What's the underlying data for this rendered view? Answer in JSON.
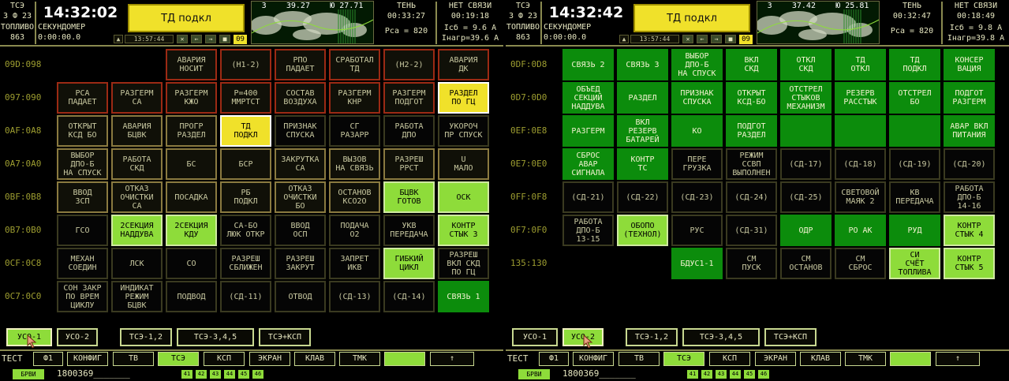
{
  "panels": [
    {
      "header": {
        "tse": "ТСЭ",
        "f": "3 Ф 23",
        "toplivo_label": "ТОПЛИВО",
        "toplivo": "863",
        "clock": "14:32:02",
        "stopwatch_label": "СЕКУНДОМЕР",
        "stopwatch": "0:00:00.0",
        "message": "ТД подкл",
        "map_a": "3",
        "map_b": "39.27",
        "map_c": "Ю 27.71",
        "shadow_label": "ТЕНЬ",
        "shadow": "00:33:27",
        "pca": "Рса = 820",
        "nolink_label": "НЕТ СВЯЗИ",
        "nolink": "00:19:18",
        "isb": "Iсб = 9.6 А",
        "inagr": "Iнагр=39.6 А",
        "toolbar_time": "13:57:44",
        "page": "09"
      },
      "rows": [
        {
          "label": "09D:098",
          "cells": [
            {
              "t": "",
              "s": "e"
            },
            {
              "t": "",
              "s": "e"
            },
            {
              "t": "АВАРИЯ\nНОСИТ",
              "s": "r"
            },
            {
              "t": "(Н1-2)",
              "s": "r"
            },
            {
              "t": "РПО\nПАДАЕТ",
              "s": "r"
            },
            {
              "t": "СРАБОТАЛ\nТД",
              "s": "r"
            },
            {
              "t": "(Н2-2)",
              "s": "r"
            },
            {
              "t": "АВАРИЯ\nДК",
              "s": "r"
            }
          ]
        },
        {
          "label": "097:090",
          "cells": [
            {
              "t": "РСА\nПАДАЕТ",
              "s": "r"
            },
            {
              "t": "РАЗГЕРМ\nСА",
              "s": "r"
            },
            {
              "t": "РАЗГЕРМ\nКЖО",
              "s": "r"
            },
            {
              "t": "Р=400\nММРТСТ",
              "s": "r"
            },
            {
              "t": "СОСТАВ\nВОЗДУХА",
              "s": "r"
            },
            {
              "t": "РАЗГЕРМ\nКНР",
              "s": "r"
            },
            {
              "t": "РАЗГЕРМ\nПОДГОТ",
              "s": "r"
            },
            {
              "t": "РАЗДЕЛ\nПО ГЦ",
              "s": "y"
            }
          ]
        },
        {
          "label": "0AF:0A8",
          "cells": [
            {
              "t": "ОТКРЫТ\nКСД БО",
              "s": "b"
            },
            {
              "t": "АВАРИЯ\nБЦВК",
              "s": "b"
            },
            {
              "t": "ПРОГР\nРАЗДЕЛ",
              "s": "b"
            },
            {
              "t": "ТД\nПОДКЛ",
              "s": "y"
            },
            {
              "t": "ПРИЗНАК\nСПУСКА",
              "s": "k"
            },
            {
              "t": "СГ\nРАЗАРР",
              "s": "k"
            },
            {
              "t": "РАБОТА\nДПО",
              "s": "k"
            },
            {
              "t": "УКОРОЧ\nПР СПУСК",
              "s": "k"
            }
          ]
        },
        {
          "label": "0A7:0A0",
          "cells": [
            {
              "t": "ВЫБОР\nДПО-Б\nНА СПУСК",
              "s": "b"
            },
            {
              "t": "РАБОТА\nСКД",
              "s": "b"
            },
            {
              "t": "БС",
              "s": "b"
            },
            {
              "t": "БСР",
              "s": "b"
            },
            {
              "t": "ЗАКРУТКА\nСА",
              "s": "b"
            },
            {
              "t": "ВЫЗОВ\nНА СВЯЗЬ",
              "s": "b"
            },
            {
              "t": "РАЗРЕШ\nРРСТ",
              "s": "b"
            },
            {
              "t": "U\nМАЛО",
              "s": "b"
            }
          ]
        },
        {
          "label": "0BF:0B8",
          "cells": [
            {
              "t": "ВВОД\nЗСП",
              "s": "b"
            },
            {
              "t": "ОТКАЗ\nОЧИСТКИ\nСА",
              "s": "b"
            },
            {
              "t": "ПОСАДКА",
              "s": "b"
            },
            {
              "t": "РБ\nПОДКЛ",
              "s": "b"
            },
            {
              "t": "ОТКАЗ\nОЧИСТКИ\nБО",
              "s": "b"
            },
            {
              "t": "ОСТАНОВ\nКСО2О",
              "s": "b"
            },
            {
              "t": "БЦВК\nГОТОВ",
              "s": "lg"
            },
            {
              "t": "ОСК",
              "s": "lg"
            }
          ]
        },
        {
          "label": "0B7:0B0",
          "cells": [
            {
              "t": "ГСО",
              "s": "k"
            },
            {
              "t": "2СЕКЦИЯ\nНАДДУВА",
              "s": "lg"
            },
            {
              "t": "2СЕКЦИЯ\nКДУ",
              "s": "lg"
            },
            {
              "t": "СА-БО\nЛЮК ОТКР",
              "s": "k"
            },
            {
              "t": "ВВОД\nОСП",
              "s": "k"
            },
            {
              "t": "ПОДАЧА\nО2",
              "s": "k"
            },
            {
              "t": "УКВ\nПЕРЕДАЧА",
              "s": "k"
            },
            {
              "t": "КОНТР\nСТЫК 3",
              "s": "lg"
            }
          ]
        },
        {
          "label": "0CF:0C8",
          "cells": [
            {
              "t": "МЕХАН\nСОЕДИН",
              "s": "k"
            },
            {
              "t": "ЛСК",
              "s": "k"
            },
            {
              "t": "СО",
              "s": "k"
            },
            {
              "t": "РАЗРЕШ\nСБЛИЖЕН",
              "s": "k"
            },
            {
              "t": "РАЗРЕШ\nЗАКРУТ",
              "s": "k"
            },
            {
              "t": "ЗАПРЕТ\nИКВ",
              "s": "k"
            },
            {
              "t": "ГИБКИЙ\nЦИКЛ",
              "s": "lg"
            },
            {
              "t": "РАЗРЕШ\nВКЛ СКД\nПО ГЦ",
              "s": "k"
            }
          ]
        },
        {
          "label": "0C7:0C0",
          "cells": [
            {
              "t": "СОН ЗАКР\nПО ВРЕМ\nЦИКЛУ",
              "s": "k"
            },
            {
              "t": "ИНДИКАТ\nРЕЖИМ\nБЦВК",
              "s": "k"
            },
            {
              "t": "ПОДВОД",
              "s": "k"
            },
            {
              "t": "(СД-11)",
              "s": "k"
            },
            {
              "t": "ОТВОД",
              "s": "k"
            },
            {
              "t": "(СД-13)",
              "s": "k"
            },
            {
              "t": "(СД-14)",
              "s": "k"
            },
            {
              "t": "СВЯЗЬ 1",
              "s": "g"
            }
          ]
        }
      ],
      "uso": [
        {
          "label": "УСО-1",
          "active": true
        },
        {
          "label": "УСО-2",
          "active": false
        },
        {
          "label": "ТСЭ-1,2",
          "active": false
        },
        {
          "label": "ТСЭ-3,4,5",
          "active": false
        },
        {
          "label": "ТСЭ+КСП",
          "active": false
        }
      ],
      "cursor_on": 0
    },
    {
      "header": {
        "tse": "ТСЭ",
        "f": "3 Ф 23",
        "toplivo_label": "ТОПЛИВО",
        "toplivo": "863",
        "clock": "14:32:42",
        "stopwatch_label": "СЕКУНДОМЕР",
        "stopwatch": "0:00:00.0",
        "message": "ТД подкл",
        "map_a": "3",
        "map_b": "37.42",
        "map_c": "Ю 25.81",
        "shadow_label": "ТЕНЬ",
        "shadow": "00:32:47",
        "pca": "Рса = 820",
        "nolink_label": "НЕТ СВЯЗИ",
        "nolink": "00:18:49",
        "isb": "Iсб = 9.8 А",
        "inagr": "Iнагр=39.8 А",
        "toolbar_time": "13:57:44",
        "page": "09"
      },
      "rows": [
        {
          "label": "0DF:0D8",
          "cells": [
            {
              "t": "СВЯЗЬ 2",
              "s": "g"
            },
            {
              "t": "СВЯЗЬ 3",
              "s": "g"
            },
            {
              "t": "ВЫБОР\nДПО-Б\nНА СПУСК",
              "s": "g"
            },
            {
              "t": "ВКЛ\nСКД",
              "s": "g"
            },
            {
              "t": "ОТКЛ\nСКД",
              "s": "g"
            },
            {
              "t": "ТД\nОТКЛ",
              "s": "g"
            },
            {
              "t": "ТД\nПОДКЛ",
              "s": "g"
            },
            {
              "t": "КОНСЕР\nВАЦИЯ",
              "s": "g"
            }
          ]
        },
        {
          "label": "0D7:0D0",
          "cells": [
            {
              "t": "ОБЪЕД\nСЕКЦИЙ\nНАДДУВА",
              "s": "g"
            },
            {
              "t": "РАЗДЕЛ",
              "s": "g"
            },
            {
              "t": "ПРИЗНАК\nСПУСКА",
              "s": "g"
            },
            {
              "t": "ОТКРЫТ\nКСД-БО",
              "s": "g"
            },
            {
              "t": "ОТСТРЕЛ\nСТЫКОВ\nМЕХАНИЗМ",
              "s": "g"
            },
            {
              "t": "РЕЗЕРВ\nРАССТЫК",
              "s": "g"
            },
            {
              "t": "ОТСТРЕЛ\nБО",
              "s": "g"
            },
            {
              "t": "ПОДГОТ\nРАЗГЕРМ",
              "s": "g"
            }
          ]
        },
        {
          "label": "0EF:0E8",
          "cells": [
            {
              "t": "РАЗГЕРМ",
              "s": "g"
            },
            {
              "t": "ВКЛ\nРЕЗЕРВ\nБАТАРЕЙ",
              "s": "g"
            },
            {
              "t": "КО",
              "s": "g"
            },
            {
              "t": "ПОДГОТ\nРАЗДЕЛ",
              "s": "g"
            },
            {
              "t": "",
              "s": "g"
            },
            {
              "t": "",
              "s": "g"
            },
            {
              "t": "",
              "s": "g"
            },
            {
              "t": "АВАР ВКЛ\nПИТАНИЯ",
              "s": "g"
            }
          ]
        },
        {
          "label": "0E7:0E0",
          "cells": [
            {
              "t": "СБРОС\nАВАР\nСИГНАЛА",
              "s": "g"
            },
            {
              "t": "КОНТР\nТС",
              "s": "g"
            },
            {
              "t": "ПЕРЕ\nГРУЗКА",
              "s": "k"
            },
            {
              "t": "РЕЖИМ\nССВП\nВЫПОЛНЕН",
              "s": "k"
            },
            {
              "t": "(СД-17)",
              "s": "k"
            },
            {
              "t": "(СД-18)",
              "s": "k"
            },
            {
              "t": "(СД-19)",
              "s": "k"
            },
            {
              "t": "(СД-20)",
              "s": "k"
            }
          ]
        },
        {
          "label": "0FF:0F8",
          "cells": [
            {
              "t": "(СД-21)",
              "s": "k"
            },
            {
              "t": "(СД-22)",
              "s": "k"
            },
            {
              "t": "(СД-23)",
              "s": "k"
            },
            {
              "t": "(СД-24)",
              "s": "k"
            },
            {
              "t": "(СД-25)",
              "s": "k"
            },
            {
              "t": "СВЕТОВОЙ\nМАЯК 2",
              "s": "k"
            },
            {
              "t": "КВ\nПЕРЕДАЧА",
              "s": "k"
            },
            {
              "t": "РАБОТА\nДПО-Б\n14-16",
              "s": "k"
            }
          ]
        },
        {
          "label": "0F7:0F0",
          "cells": [
            {
              "t": "РАБОТА\nДПО-Б\n13-15",
              "s": "k"
            },
            {
              "t": "ОБОПО\n(ТЕХНОЛ)",
              "s": "lg"
            },
            {
              "t": "РУС",
              "s": "k"
            },
            {
              "t": "(СД-31)",
              "s": "k"
            },
            {
              "t": "ОДР",
              "s": "g"
            },
            {
              "t": "РО АК",
              "s": "g"
            },
            {
              "t": "РУД",
              "s": "g"
            },
            {
              "t": "КОНТР\nСТЫК 4",
              "s": "lg"
            }
          ]
        },
        {
          "label": "135:130",
          "cells": [
            {
              "t": "",
              "s": "e"
            },
            {
              "t": "",
              "s": "e"
            },
            {
              "t": "БДУС1-1",
              "s": "g"
            },
            {
              "t": "СМ\nПУСК",
              "s": "k"
            },
            {
              "t": "СМ\nОСТАНОВ",
              "s": "k"
            },
            {
              "t": "СМ\nСБРОС",
              "s": "k"
            },
            {
              "t": "СИ\nСЧЁТ\nТОПЛИВА",
              "s": "lg"
            },
            {
              "t": "КОНТР\nСТЫК 5",
              "s": "lg"
            }
          ]
        }
      ],
      "uso": [
        {
          "label": "УСО-1",
          "active": false
        },
        {
          "label": "УСО-2",
          "active": true
        },
        {
          "label": "ТСЭ-1,2",
          "active": false
        },
        {
          "label": "ТСЭ-3,4,5",
          "active": false
        },
        {
          "label": "ТСЭ+КСП",
          "active": false
        }
      ],
      "cursor_on": 1
    }
  ],
  "footer": {
    "test_label": "ТЕСТ",
    "buttons": [
      "Ф1",
      "КОНФИГ",
      "ТВ",
      "ТСЭ",
      "КСП",
      "ЭКРАН",
      "КЛАВ",
      "ТМК",
      "",
      "↑"
    ],
    "active_button": "ТСЭ",
    "brvi": "БРВИ",
    "number": "1800369_______",
    "squares": [
      "41",
      "42",
      "43",
      "44",
      "45",
      "46"
    ]
  },
  "colors": {
    "background": "#000000",
    "alarm_border": "#9c2a14",
    "highlight_yellow": "#f0e12a",
    "light_green": "#8edc3a",
    "dark_green": "#0c8c0c",
    "row_label": "#9d9d30"
  },
  "icons": [
    "close-icon",
    "arrow-left-icon",
    "arrow-right-icon",
    "stop-square-icon",
    "mouse-cursor-icon",
    "up-arrow-icon"
  ]
}
